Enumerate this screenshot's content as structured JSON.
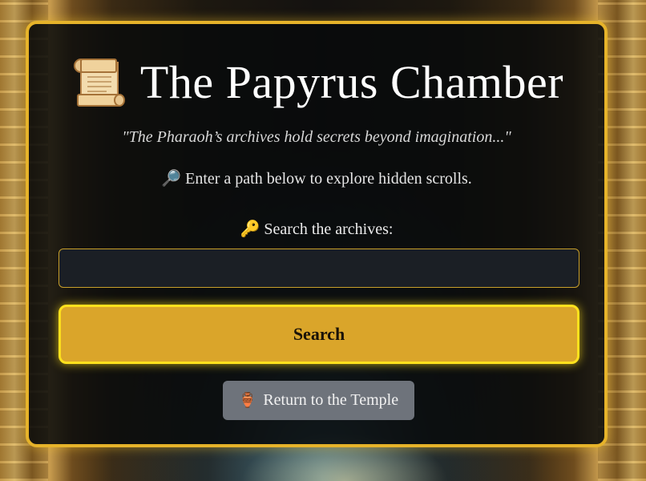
{
  "page": {
    "title": "The Papyrus Chamber",
    "title_icon": "scroll-icon",
    "quote": "\"The Pharaoh’s archives hold secrets beyond imagination...\"",
    "intro": {
      "icon": "🔎",
      "text": "Enter a path below to explore hidden scrolls."
    }
  },
  "search": {
    "label_icon": "🔑",
    "label": "Search the archives:",
    "value": "",
    "placeholder": "",
    "button_label": "Search"
  },
  "nav": {
    "return_icon": "🏺",
    "return_label": "Return to the Temple"
  },
  "colors": {
    "accent_gold": "#e6b32a",
    "button_gold": "#daa52a",
    "button_glow": "#ffe11d",
    "panel_bg": "#080a0c",
    "input_bg": "#1b1f25",
    "secondary_button": "#6e737b"
  }
}
